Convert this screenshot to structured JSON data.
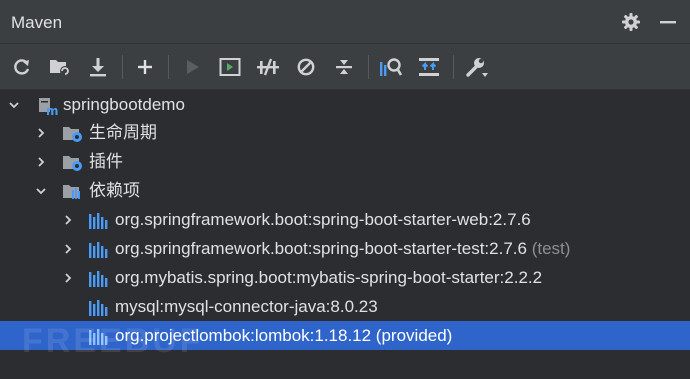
{
  "window": {
    "title": "Maven"
  },
  "header_icons": [
    "gear-icon",
    "minimize-icon"
  ],
  "toolbar": {
    "buttons": [
      {
        "name": "reload-all-icon"
      },
      {
        "name": "generate-sources-icon"
      },
      {
        "name": "download-icon"
      },
      {
        "name": "add-project-icon"
      },
      {
        "name": "run-icon"
      },
      {
        "name": "execute-goal-icon"
      },
      {
        "name": "toggle-offline-icon"
      },
      {
        "name": "skip-tests-icon"
      },
      {
        "name": "collapse-all-icon"
      },
      {
        "name": "analyze-dependencies-icon"
      },
      {
        "name": "show-diagram-icon"
      },
      {
        "name": "settings-wrench-icon"
      }
    ]
  },
  "tree": {
    "project": {
      "label": "springbootdemo"
    },
    "lifecycle": {
      "label": "生命周期"
    },
    "plugins": {
      "label": "插件"
    },
    "dependencies": {
      "label": "依赖项"
    },
    "deps": [
      {
        "label": "org.springframework.boot:spring-boot-starter-web:2.7.6",
        "scope": ""
      },
      {
        "label": "org.springframework.boot:spring-boot-starter-test:2.7.6",
        "scope": "(test)"
      },
      {
        "label": "org.mybatis.spring.boot:mybatis-spring-boot-starter:2.2.2",
        "scope": ""
      },
      {
        "label": "mysql:mysql-connector-java:8.0.23",
        "scope": ""
      },
      {
        "label": "org.projectlombok:lombok:1.18.12 (provided)",
        "scope": ""
      }
    ]
  },
  "watermark": {
    "text": "FREEBUF"
  },
  "colors": {
    "selection": "#2f65ca",
    "panel": "#2b2d30",
    "toolbar": "#3c3f41",
    "accent_blue": "#4b9bf5",
    "run_green": "#59a869"
  }
}
